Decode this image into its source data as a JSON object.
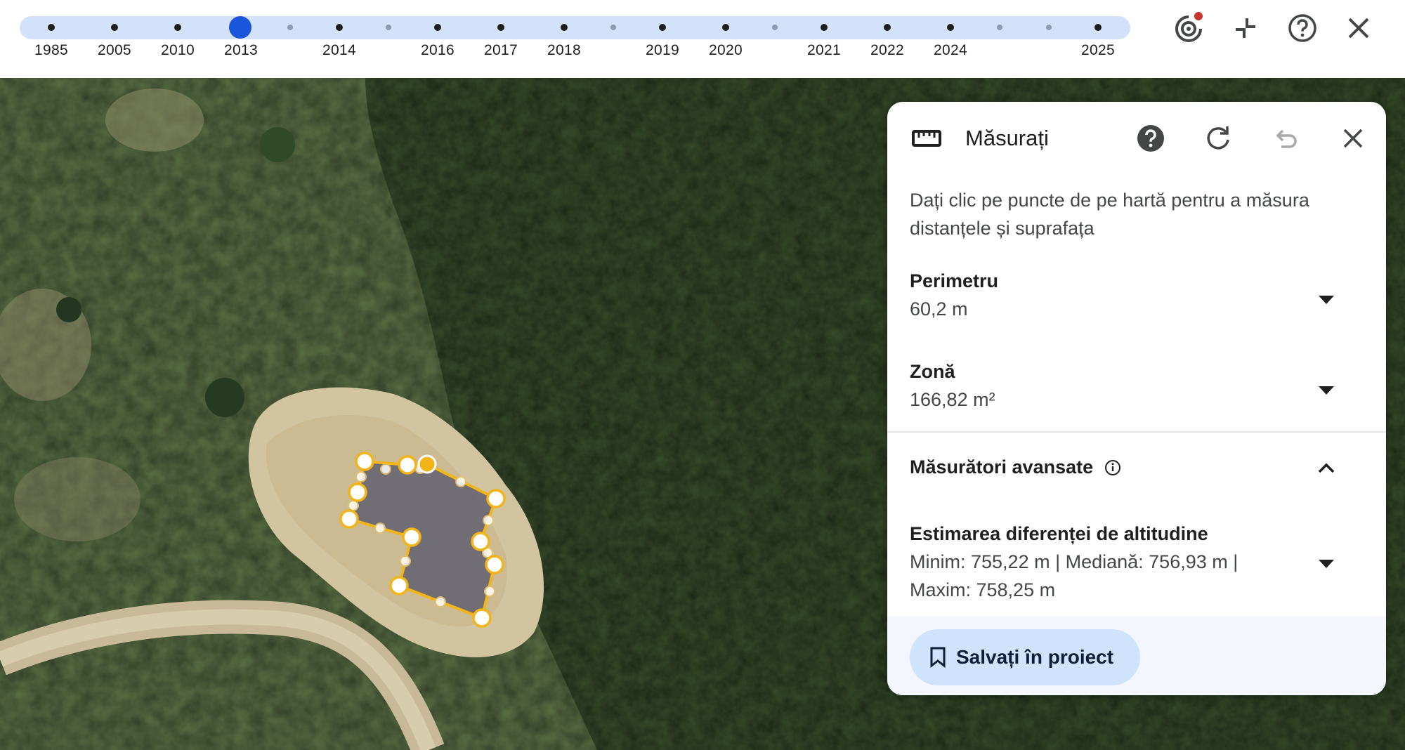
{
  "timeline": {
    "years": [
      "1985",
      "2005",
      "2010",
      "2013",
      "2014",
      "2016",
      "2017",
      "2018",
      "2019",
      "2020",
      "2021",
      "2022",
      "2024",
      "2025"
    ],
    "selected_year": "2013"
  },
  "top_icons": [
    "timelapse-icon",
    "exit-fullscreen-icon",
    "help-icon",
    "close-icon"
  ],
  "panel": {
    "title": "Măsurați",
    "description": "Dați clic pe puncte de pe hartă pentru a măsura distanțele și suprafața",
    "perimeter": {
      "label": "Perimetru",
      "value": "60,2 m"
    },
    "area": {
      "label": "Zonă",
      "value": "166,82 m²"
    },
    "advanced": {
      "label": "Măsurători avansate",
      "state": "expanded"
    },
    "elevation": {
      "label": "Estimarea diferenței de altitudine",
      "value_line1": "Minim: 755,22 m | Mediană: 756,93 m |",
      "value_line2": "Maxim: 758,25 m"
    },
    "save_button": "Salvați în proiect"
  },
  "colors": {
    "accent": "#1a56db",
    "timeline_track": "#d2e2fb",
    "measure_outline": "#f2b417",
    "save_button_bg": "#cfe3fc",
    "notification_dot": "#c5372e"
  }
}
